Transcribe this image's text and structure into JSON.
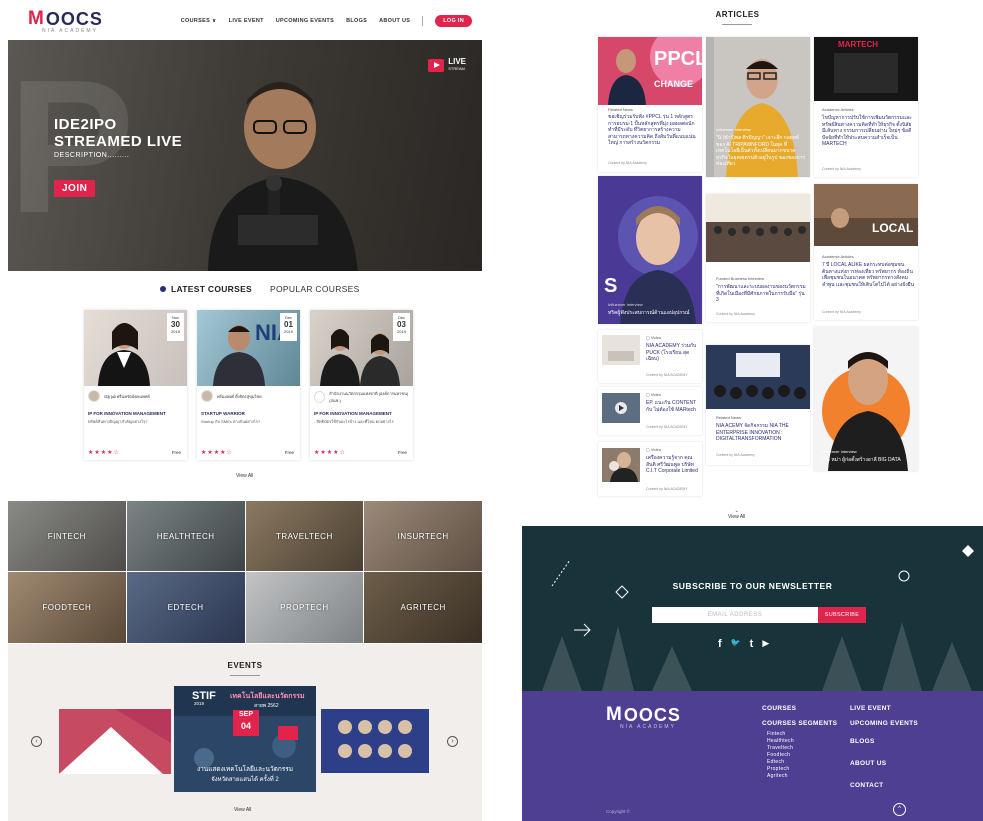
{
  "header": {
    "logo": "OOCS",
    "logo_sub": "NIA ACADEMY",
    "nav": [
      "COURSES ∨",
      "LIVE EVENT",
      "UPCOMING EVENTS",
      "BLOGS",
      "ABOUT US"
    ],
    "login": "LOG IN"
  },
  "hero": {
    "title_line1": "IDE2IPO",
    "title_line2": "STREAMED LIVE",
    "description": "DESCRIPTION.........",
    "join": "JOIN",
    "live": "LIVE",
    "live_sub": "STREAM"
  },
  "course_tabs": {
    "active": "LATEST COURSES",
    "other": "POPULAR COURSES"
  },
  "courses": [
    {
      "month": "Nov",
      "day": "30",
      "year": "2019",
      "author": "ณัฐวุฒิ ศรีนพรัตน์ขยแพทย์",
      "title": "IP FOR INNOVATION MANAGEMENT",
      "desc": "ทรัพย์สินทางปัญญาสำคัญอย่างไร?",
      "rating": "★★★★☆",
      "price": "Free"
    },
    {
      "month": "Dec",
      "day": "01",
      "year": "2019",
      "author": "พร้อมพงศ์ ตั้งจิตรสุขุมไชย",
      "title": "STARTUP WARRIOR",
      "desc": "Startup กับ SMEs ต่างกันอย่างไร?",
      "rating": "★★★★☆",
      "price": "Free"
    },
    {
      "month": "Dec",
      "day": "03",
      "year": "2019",
      "author": "สำนักงานนวัตกรรมแห่งชาติ (องค์การมหาชน) (สนช.)",
      "title": "IP FOR INNOVATION MANAGEMENT",
      "desc": "- สิทธิบัตรใช้กับอะไรบ้าง และที่ไหน ยกอย่างไร",
      "rating": "★★★★☆",
      "price": "Free"
    }
  ],
  "view_all": "View All",
  "techs": [
    "FINTECH",
    "HEALTHTECH",
    "TRAVELTECH",
    "INSURTECH",
    "FOODTECH",
    "EDTECH",
    "PROPTECH",
    "AGRITECH"
  ],
  "events": {
    "title": "EVENTS",
    "featured": {
      "brand": "STIF",
      "year": "2019",
      "month": "SEP",
      "day": "04",
      "headline": "งานแสดงเทคโนโลยีและนวัตกรรม",
      "subline": "จังหวัดสายแสนได้ ครั้งที่ 2",
      "line": "เทคโนโลยีและนวัตกรรม",
      "sub2": "สายพ 2562"
    },
    "prev": "‹",
    "next": "›"
  },
  "articles": {
    "title": "ARTICLES",
    "items": [
      {
        "cat": "Related News",
        "title": "ขอเชิญร่วมรับฟัง #PPCL รุ่น 1 หลักสูตรการอบรม-1 ปั้นหลักสูตรที่มุ่ง ผลผลต่อนักทำที่มีระดับ ที่วิตยาการสร้างความ สามารถทางความคิด ถึงสัมวันที่แนบแน่นใหญ่ การสร้างนวัตกรรม",
        "meta": "Content by NIA Academy",
        "img_text": "PPCL",
        "img_sub": "CHANGE"
      },
      {
        "cat": "Influencer Interview",
        "title": "\"นิ (ชำร์)พล ศิรปัญญา\" เจาะลึก กลยุทธ์ของ AI TRIPAWNFORD ในยุค ที่เทคโนโลยีเป็นตัวทั้งเปลี่ยนมากขนาด ธุรกิจในยุคสเตรนสิวอยู่ในรูป ของของการท่องเที่ยว",
        "meta": "Content by NIA Academy"
      },
      {
        "cat": "Academic Articles",
        "title": "ไขปัญหาการปรับใช้การเพิ่มนวัตกรรมและ ทรัพย์สินทางความคิดที่ทำให้ธุรกิจ ตั้งนิสัยมีเส้นทาง กรรมการเปลี่ยนผ่าน ใหม่ๆ ข้อดีปัจจัยที่ทำให้ประสบความสำเร็จเป็น MARTECH",
        "meta": "Content by NIA Academy",
        "img_text": "MARTECH"
      },
      {
        "cat": "Influencer Interview",
        "title": "ทริคผู้ฟังประสบการณ์ด้านแอปอุปกรณ์",
        "meta": "",
        "img_text": "S"
      },
      {
        "cat": "Funded Business Interview",
        "title": "\"การพัฒนาและระบบผลงานของนวัตกรรมที่เกิดในเมืองที่มีศักยภาพในการรับมือ\" รุ่น 3",
        "meta": "Content by NIA Academy"
      },
      {
        "cat": "Academic Articles",
        "title": "7 ปี LOCAL ALIKE ผลกระทบต่อชุมชน ต้นทางแห่งการท่องเที่ยว ทรัพยากร ท้องถิ่นเพื่อชุมชนในอนาคต ทรัพยากรทางสังคม ลำพูน และชุมชนให้เติบโตไปได้ อย่างยั่งยืน",
        "meta": "Content by NIA Academy",
        "img_text": "LOCAL"
      },
      {
        "cat": "Video",
        "title": "NIA ACADEMY ร่วมกับ PUCK (โรงเรียน สุดเฉียบ)",
        "meta": "Content by NIA ACADEMY"
      },
      {
        "cat": "Related News",
        "title": "NIA ACEMY จัดกิจกรรม NIA THE ENTERPRISE INNOVATION : DIGITALTRANSFORMATION",
        "meta": "Content by NIA Academy"
      },
      {
        "cat": "Influencer Interview",
        "title": "เจ้คิ หม่า ผู้ก่อตั้งสร้างอาลี BIG DATA",
        "meta": ""
      },
      {
        "cat": "Video",
        "title": "EP. แนะกัน CONTENT กับ ไม่ต้องใช้ MARtech",
        "meta": "Content by NIA ACADEMY"
      },
      {
        "cat": "Video",
        "title": "เครื่องความรู้จาก คุณสันติ ศรีวัฒนพูล บริษัท C.I.T Corporate Limited",
        "meta": "Content by NIA ACADEMY"
      }
    ],
    "view_all": "View All"
  },
  "newsletter": {
    "title": "SUBSCRIBE TO OUR NEWSLETTER",
    "placeholder": "EMAIL ADDRESS",
    "button": "SUBSCRIBE",
    "socials": [
      "f",
      "🐦",
      "t",
      "▶"
    ]
  },
  "footer": {
    "logo": "OOCS",
    "logo_sub": "NIA ACADEMY",
    "col1": "COURSES",
    "col1b": "COURSES SEGMENTS",
    "segments": [
      "Fintech",
      "Healthtech",
      "Traveltech",
      "Foodtech",
      "Edtech",
      "Proptech",
      "Agritech"
    ],
    "col2": [
      "LIVE EVENT",
      "UPCOMING EVENTS",
      "BLOGS",
      "ABOUT US",
      "CONTACT"
    ],
    "copyright": "Copyright ©",
    "up": "^"
  },
  "colors": {
    "accent": "#e0244c",
    "brand": "#2a2a5a",
    "footer": "#4e3f93"
  }
}
